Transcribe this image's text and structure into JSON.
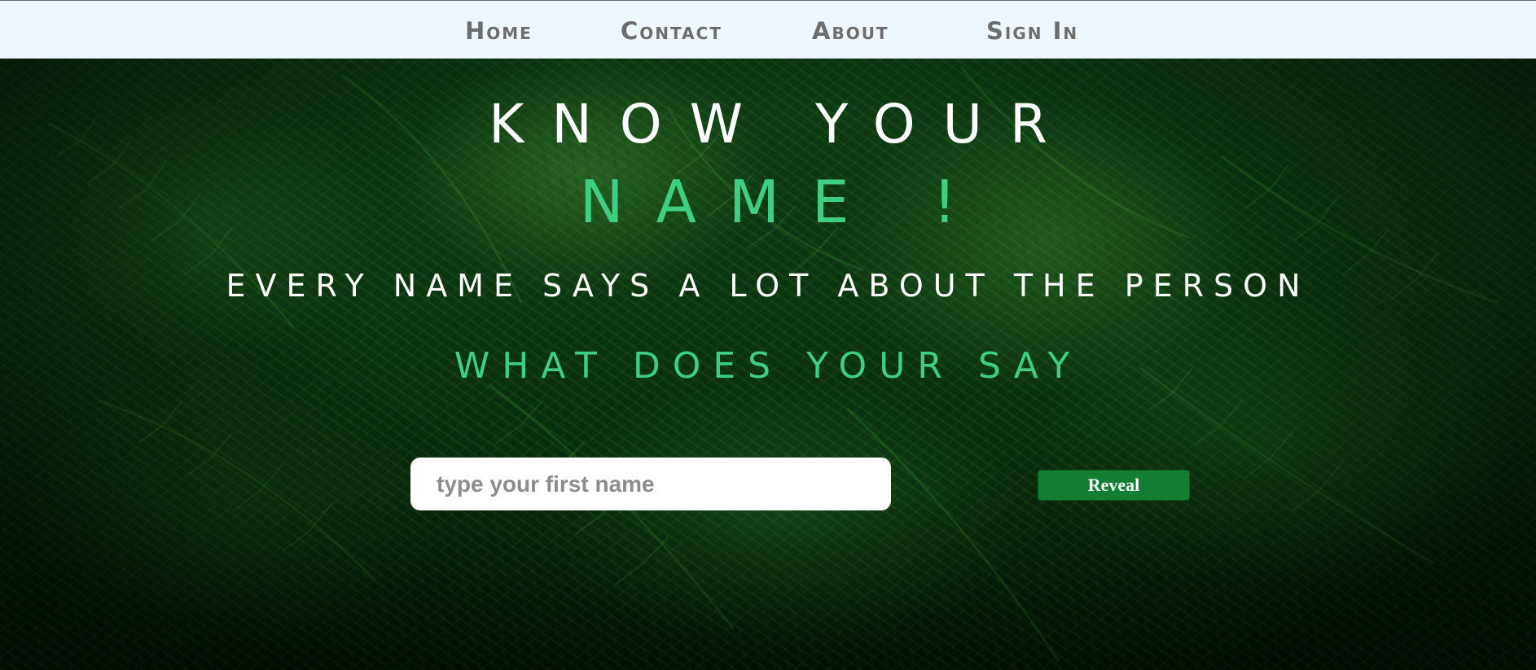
{
  "nav": {
    "items": [
      {
        "label": "Home"
      },
      {
        "label": "Contact"
      },
      {
        "label": "About"
      },
      {
        "label": "Sign In"
      }
    ]
  },
  "hero": {
    "title_line_1": "KNOW YOUR",
    "title_line_2": "NAME !",
    "tagline": "EVERY NAME SAYS A LOT ABOUT THE PERSON",
    "question": "WHAT DOES YOUR SAY"
  },
  "form": {
    "name_value": "",
    "name_placeholder": "type your first name",
    "reveal_label": "Reveal"
  },
  "colors": {
    "accent_green": "#3ecf85",
    "button_green": "#137d31",
    "nav_background": "#eef7fe",
    "nav_text": "#6d6d6d"
  },
  "background": {
    "image": "fern-foliage-photo"
  }
}
